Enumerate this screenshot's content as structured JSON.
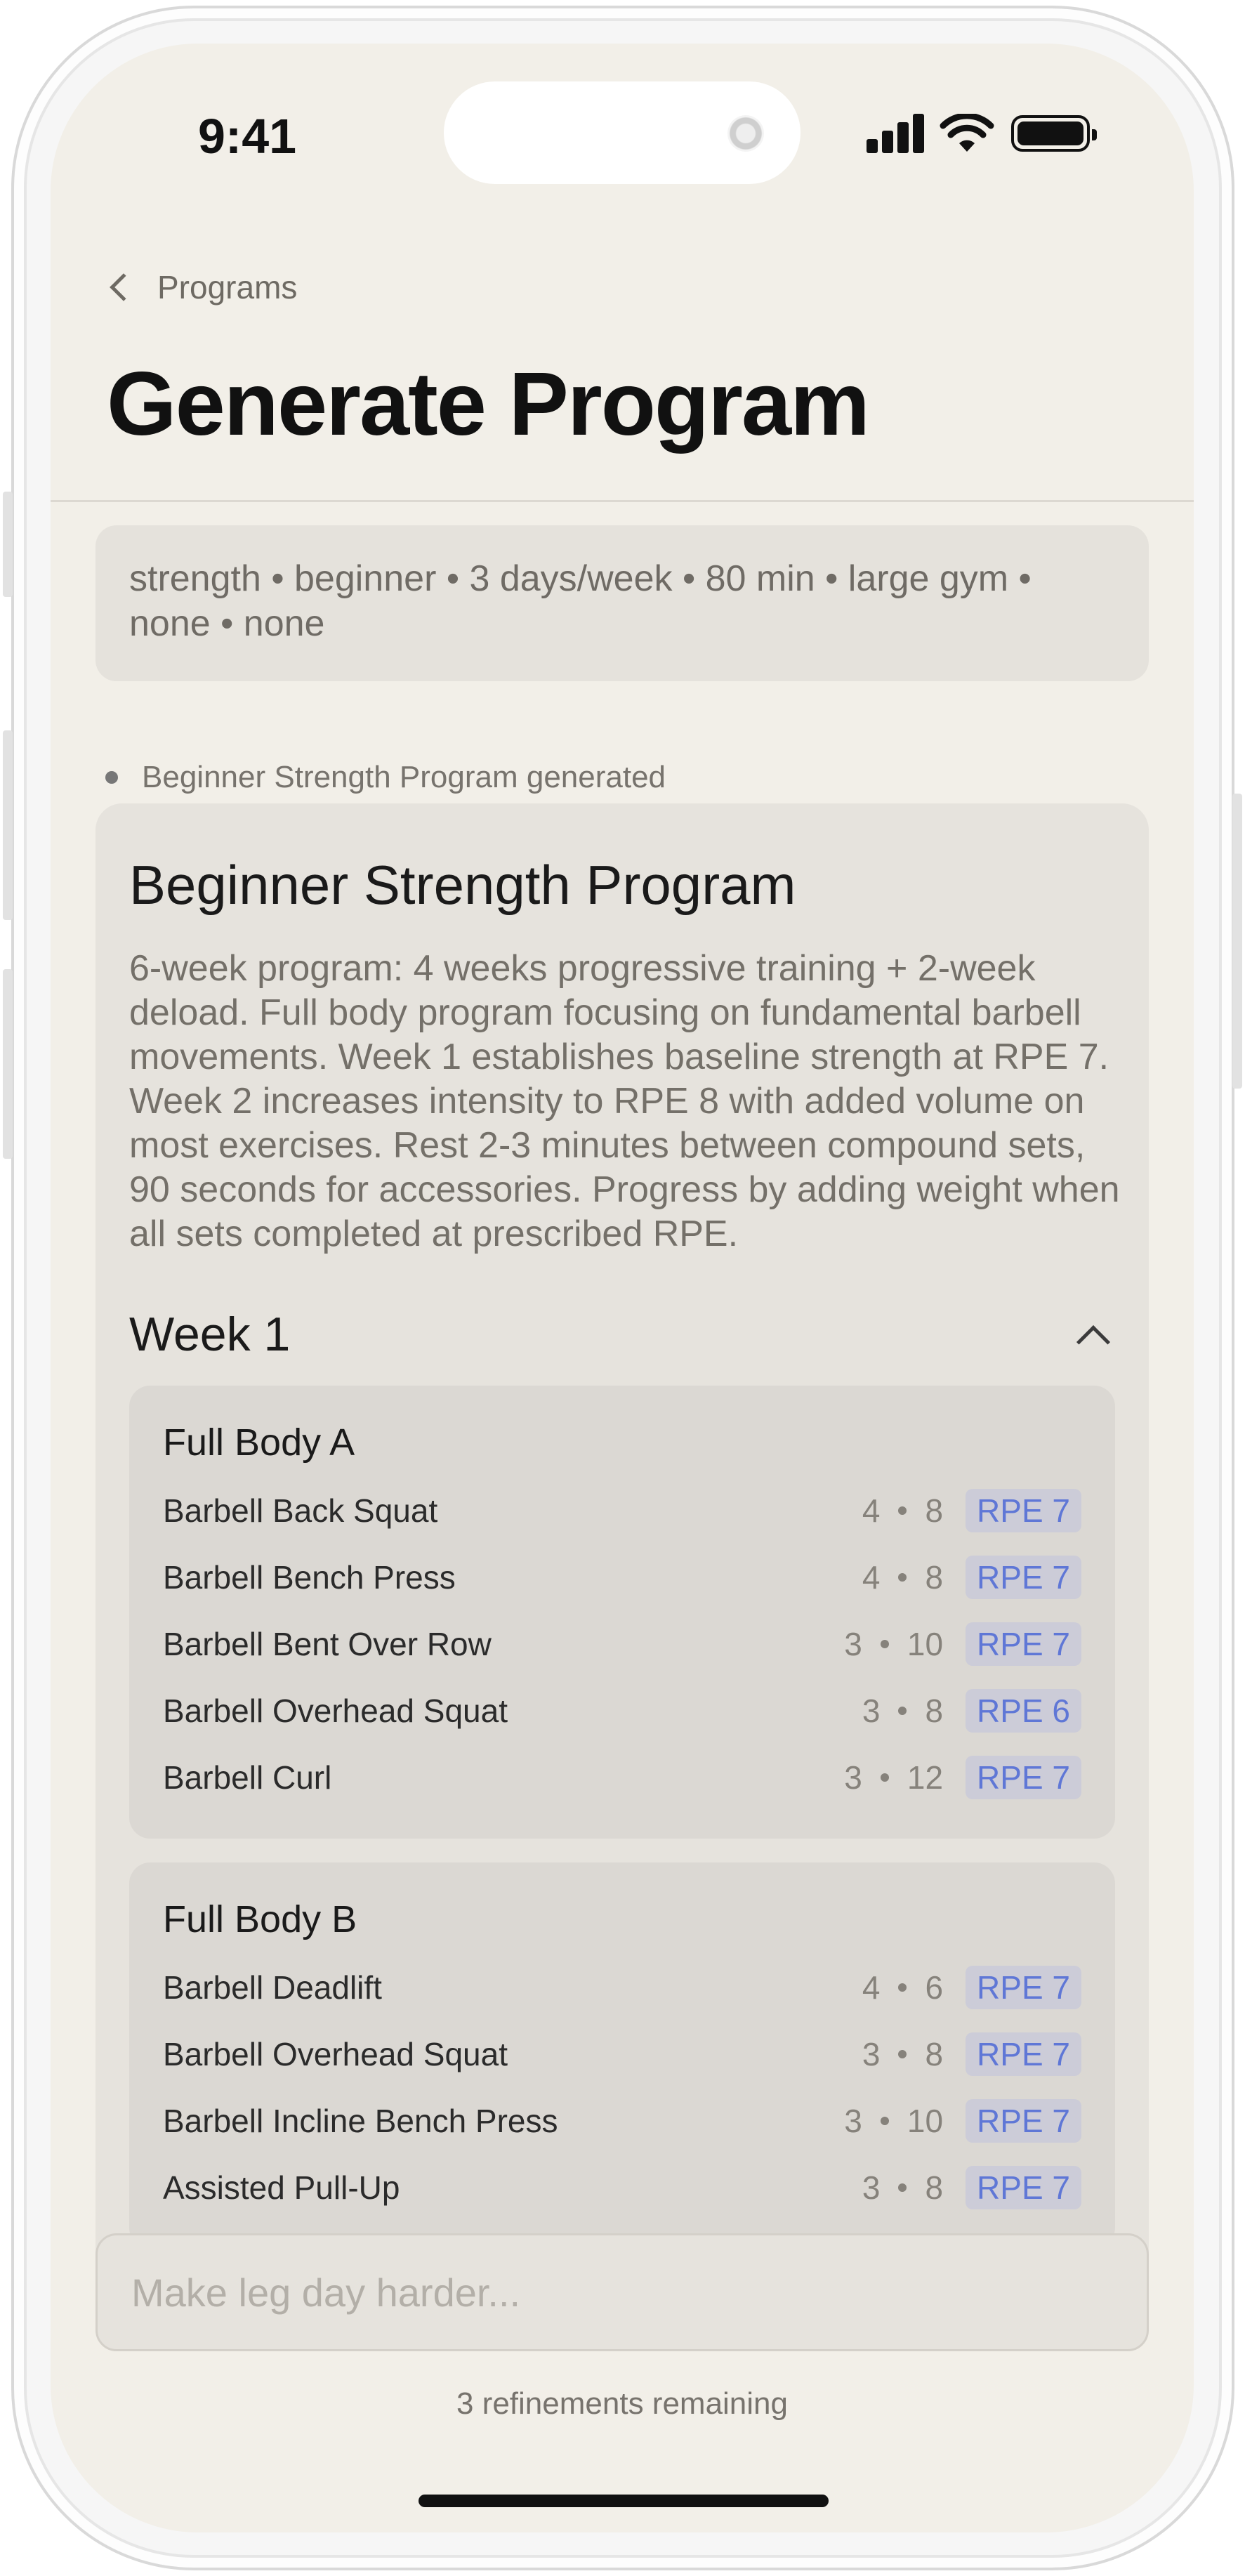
{
  "status_bar": {
    "time": "9:41"
  },
  "nav": {
    "back_label": "Programs",
    "title": "Generate Program"
  },
  "params": {
    "summary": "strength • beginner • 3 days/week • 80 min • large gym • none • none"
  },
  "generation_status": "Beginner Strength Program generated",
  "program": {
    "title": "Beginner Strength Program",
    "description": "6-week program: 4 weeks progressive training + 2-week deload. Full body program focusing on fundamental barbell movements. Week 1 establishes baseline strength at RPE 7. Week 2 increases intensity to RPE 8 with added volume on most exercises. Rest 2-3 minutes between compound sets, 90 seconds for accessories. Progress by adding weight when all sets completed at prescribed RPE.",
    "weeks": [
      {
        "title": "Week 1",
        "expanded": true,
        "workouts": [
          {
            "title": "Full Body A",
            "exercises": [
              {
                "name": "Barbell Back Squat",
                "sets": "4",
                "reps": "8",
                "rpe": "RPE 7"
              },
              {
                "name": "Barbell Bench Press",
                "sets": "4",
                "reps": "8",
                "rpe": "RPE 7"
              },
              {
                "name": "Barbell Bent Over Row",
                "sets": "3",
                "reps": "10",
                "rpe": "RPE 7"
              },
              {
                "name": "Barbell Overhead Squat",
                "sets": "3",
                "reps": "8",
                "rpe": "RPE 6"
              },
              {
                "name": "Barbell Curl",
                "sets": "3",
                "reps": "12",
                "rpe": "RPE 7"
              }
            ]
          },
          {
            "title": "Full Body B",
            "exercises": [
              {
                "name": "Barbell Deadlift",
                "sets": "4",
                "reps": "6",
                "rpe": "RPE 7"
              },
              {
                "name": "Barbell Overhead Squat",
                "sets": "3",
                "reps": "8",
                "rpe": "RPE 7"
              },
              {
                "name": "Barbell Incline Bench Press",
                "sets": "3",
                "reps": "10",
                "rpe": "RPE 7"
              },
              {
                "name": "Assisted Pull-Up",
                "sets": "3",
                "reps": "8",
                "rpe": "RPE 7"
              }
            ]
          }
        ]
      }
    ]
  },
  "refine": {
    "placeholder": "Make leg day harder...",
    "remaining": "3 refinements remaining"
  },
  "icons": {
    "back": "chevron-left-icon",
    "collapse": "chevron-up-icon",
    "signal": "cellular-signal-icon",
    "wifi": "wifi-icon",
    "battery": "battery-icon"
  },
  "colors": {
    "background": "#f2efe8",
    "card": "#e6e3dd",
    "workout_card": "#dbd8d3",
    "rpe_text": "#5f77d6",
    "rpe_badge": "#ccccd8"
  }
}
